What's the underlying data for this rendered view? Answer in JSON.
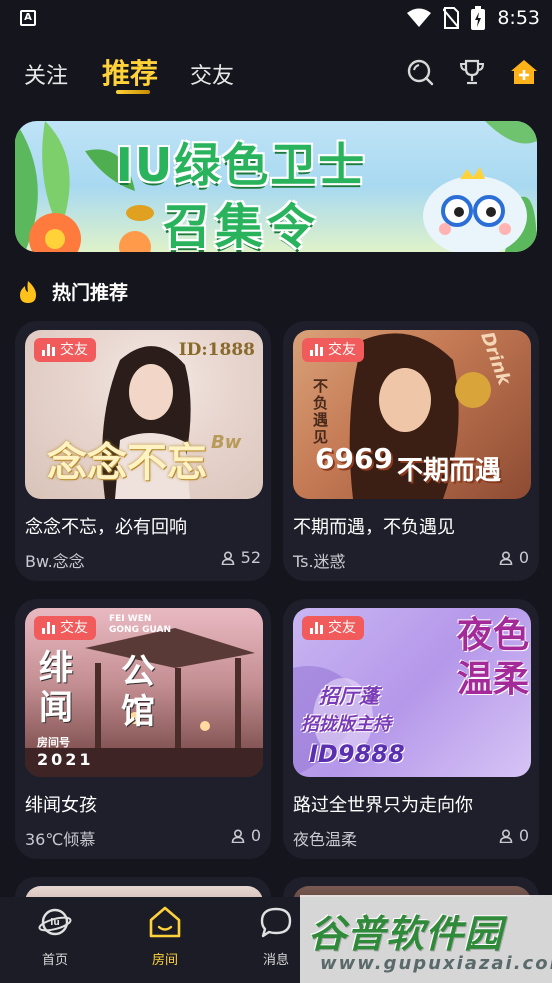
{
  "status_bar": {
    "time": "8:53",
    "left_icon": "A"
  },
  "header": {
    "tabs": [
      {
        "label": "关注",
        "active": false
      },
      {
        "label": "推荐",
        "active": true
      },
      {
        "label": "交友",
        "active": false
      }
    ],
    "icons": [
      "search-icon",
      "trophy-icon",
      "home-plus-icon"
    ]
  },
  "banner": {
    "line1": "IU绿色卫士",
    "line2": "召集令"
  },
  "section": {
    "title": "热门推荐",
    "icon": "flame-icon"
  },
  "cards": [
    {
      "tag": "交友",
      "title": "念念不忘，必有回响",
      "user": "Bw.念念",
      "count": "52",
      "image_text": {
        "main": "念念不忘",
        "id": "ID:1888",
        "sub": "Bw"
      }
    },
    {
      "tag": "交友",
      "title": "不期而遇，不负遇见",
      "user": "Ts.迷惑",
      "count": "0",
      "image_text": {
        "main": "不期而遇",
        "num": "6969",
        "side": "不负遇见",
        "corner": "Drink"
      }
    },
    {
      "tag": "交友",
      "title": "绯闻女孩",
      "user": "36℃倾慕",
      "count": "0",
      "image_text": {
        "main1": "绯闻",
        "main2": "公馆",
        "room": "房间号",
        "num": "2021",
        "top": "FEI WEN GONG GUAN"
      }
    },
    {
      "tag": "交友",
      "title": "路过全世界只为走向你",
      "user": "夜色温柔",
      "count": "0",
      "image_text": {
        "main": "夜色温柔",
        "line1": "招厅蓬",
        "line2": "招拢版主持",
        "id": "ID9888"
      }
    }
  ],
  "bottom_nav": [
    {
      "label": "首页",
      "icon": "planet-iu-icon",
      "active": false
    },
    {
      "label": "房间",
      "icon": "house-icon",
      "active": true
    },
    {
      "label": "消息",
      "icon": "chat-bubble-icon",
      "active": false
    }
  ],
  "watermark": {
    "title": "谷普软件园",
    "url": "www.gupuxiazai.com"
  },
  "colors": {
    "accent": "#ffd23a",
    "tag": "#f25b5b",
    "background": "#15151d",
    "card": "#1f1f2b"
  }
}
